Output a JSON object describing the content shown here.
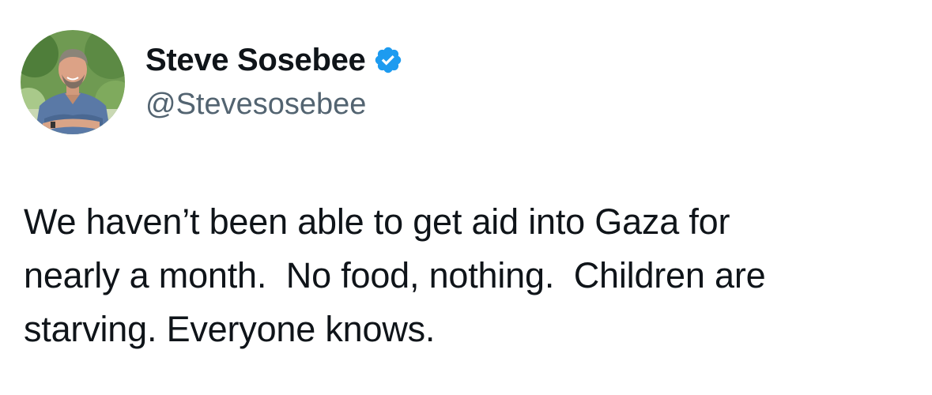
{
  "author": {
    "display_name": "Steve Sosebee",
    "handle": "@Stevesosebee",
    "verified": true,
    "verified_icon": "verified-badge-icon",
    "verified_color": "#1d9bf0"
  },
  "tweet": {
    "text": "We haven’t been able to get aid into Gaza for\nnearly a month.  No food, nothing.  Children are\nstarving. Everyone knows."
  },
  "colors": {
    "text_primary": "#0f1419",
    "text_secondary": "#536471",
    "background": "#ffffff"
  }
}
